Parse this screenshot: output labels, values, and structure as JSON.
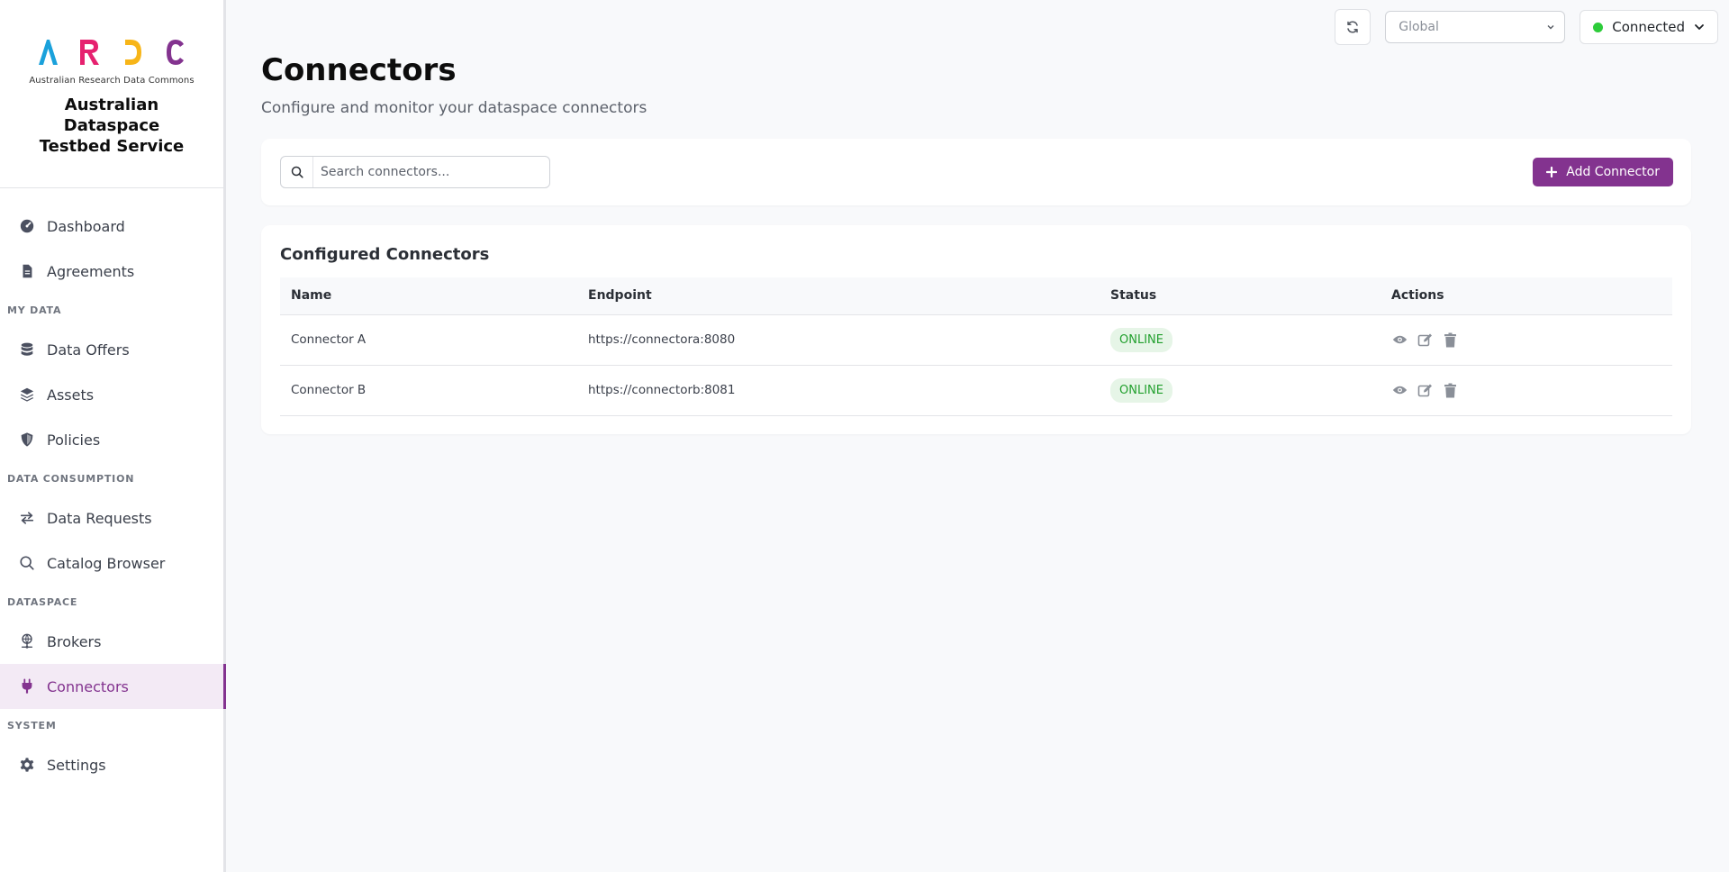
{
  "brand": {
    "logo_letters": [
      "A",
      "R",
      "D",
      "C"
    ],
    "logo_colors": [
      "#1aa1db",
      "#e6216f",
      "#f7b518",
      "#83338f"
    ],
    "logo_subtitle": "Australian Research Data Commons",
    "title_line1": "Australian Dataspace",
    "title_line2": "Testbed Service"
  },
  "sidebar": {
    "items": [
      {
        "label": "Dashboard",
        "icon": "dashboard-icon"
      },
      {
        "label": "Agreements",
        "icon": "document-icon"
      }
    ],
    "sections": [
      {
        "heading": "MY DATA",
        "items": [
          {
            "label": "Data Offers",
            "icon": "database-icon"
          },
          {
            "label": "Assets",
            "icon": "layers-icon"
          },
          {
            "label": "Policies",
            "icon": "shield-icon"
          }
        ]
      },
      {
        "heading": "DATA CONSUMPTION",
        "items": [
          {
            "label": "Data Requests",
            "icon": "exchange-icon"
          },
          {
            "label": "Catalog Browser",
            "icon": "search-icon"
          }
        ]
      },
      {
        "heading": "DATASPACE",
        "items": [
          {
            "label": "Brokers",
            "icon": "network-icon"
          },
          {
            "label": "Connectors",
            "icon": "plug-icon",
            "active": true
          }
        ]
      },
      {
        "heading": "SYSTEM",
        "items": [
          {
            "label": "Settings",
            "icon": "gear-icon"
          }
        ]
      }
    ]
  },
  "topbar": {
    "region_value": "Global",
    "connection_label": "Connected",
    "connection_color": "#2dcc3a"
  },
  "page": {
    "title": "Connectors",
    "subtitle": "Configure and monitor your dataspace connectors"
  },
  "search": {
    "placeholder": "Search connectors..."
  },
  "add_button": {
    "label": "Add Connector"
  },
  "table": {
    "title": "Configured Connectors",
    "columns": [
      "Name",
      "Endpoint",
      "Status",
      "Actions"
    ],
    "rows": [
      {
        "name": "Connector A",
        "endpoint": "https://connectora:8080",
        "status": "ONLINE"
      },
      {
        "name": "Connector B",
        "endpoint": "https://connectorb:8081",
        "status": "ONLINE"
      }
    ]
  },
  "accent_color": "#83338f"
}
